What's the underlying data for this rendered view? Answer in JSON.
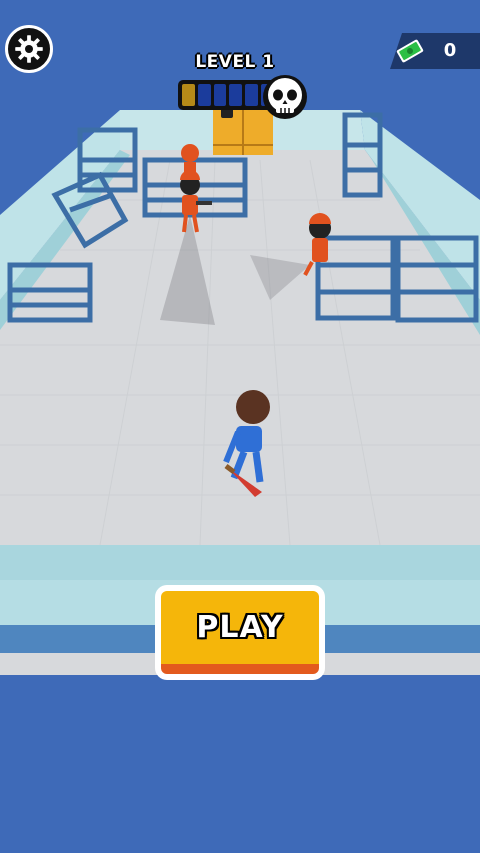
{
  "hud": {
    "level_label": "LEVEL 1",
    "money_value": "0",
    "progress": {
      "filled": 1,
      "total": 6
    }
  },
  "play_button": {
    "label": "PLAY"
  },
  "icons": {
    "settings": "gear-icon",
    "money": "cash-icon",
    "boss": "skull-icon",
    "lock": "lock-icon"
  },
  "colors": {
    "background": "#3e6ab8",
    "floor": "#d7d9dc",
    "wall": "#bfe3e8",
    "play_button": "#f5b60a",
    "play_button_edge": "#e35a1d",
    "progress_filled": "#b58a18",
    "progress_empty": "#1b3c9c",
    "enemy": "#e1521f",
    "player": "#2f6fd6"
  }
}
